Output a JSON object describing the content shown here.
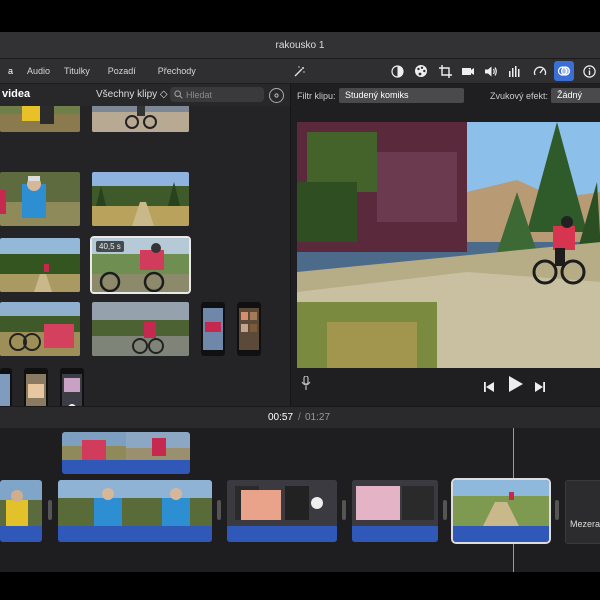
{
  "window": {
    "title": "rakousko 1"
  },
  "tabs": [
    {
      "label": "a",
      "active": true
    },
    {
      "label": "Audio",
      "active": false
    },
    {
      "label": "Titulky",
      "active": false
    },
    {
      "label": "Pozadí",
      "active": false
    },
    {
      "label": "Přechody",
      "active": false
    }
  ],
  "toolbar": {
    "icons": [
      "magic-wand-icon",
      "color-balance-icon",
      "color-palette-icon",
      "crop-icon",
      "camera-icon",
      "volume-icon",
      "equalizer-icon",
      "speedometer-icon",
      "filter-icon",
      "info-icon"
    ]
  },
  "library": {
    "title": "videa",
    "clip_filter": "Všechny klipy ◇",
    "search_placeholder": "Hledat",
    "selected_duration": "40,5 s"
  },
  "viewer": {
    "clip_filter_label": "Filtr klipu:",
    "clip_filter_value": "Studený komiks",
    "audio_effect_label": "Zvukový efekt:",
    "audio_effect_value": "Žádný"
  },
  "playback": {
    "current_time": "00:57",
    "separator": "/",
    "total_time": "01:27"
  },
  "timeline": {
    "gap_label": "Mezera"
  },
  "colors": {
    "accent_blue": "#2f58b8",
    "selection": "#e9e9e9"
  }
}
